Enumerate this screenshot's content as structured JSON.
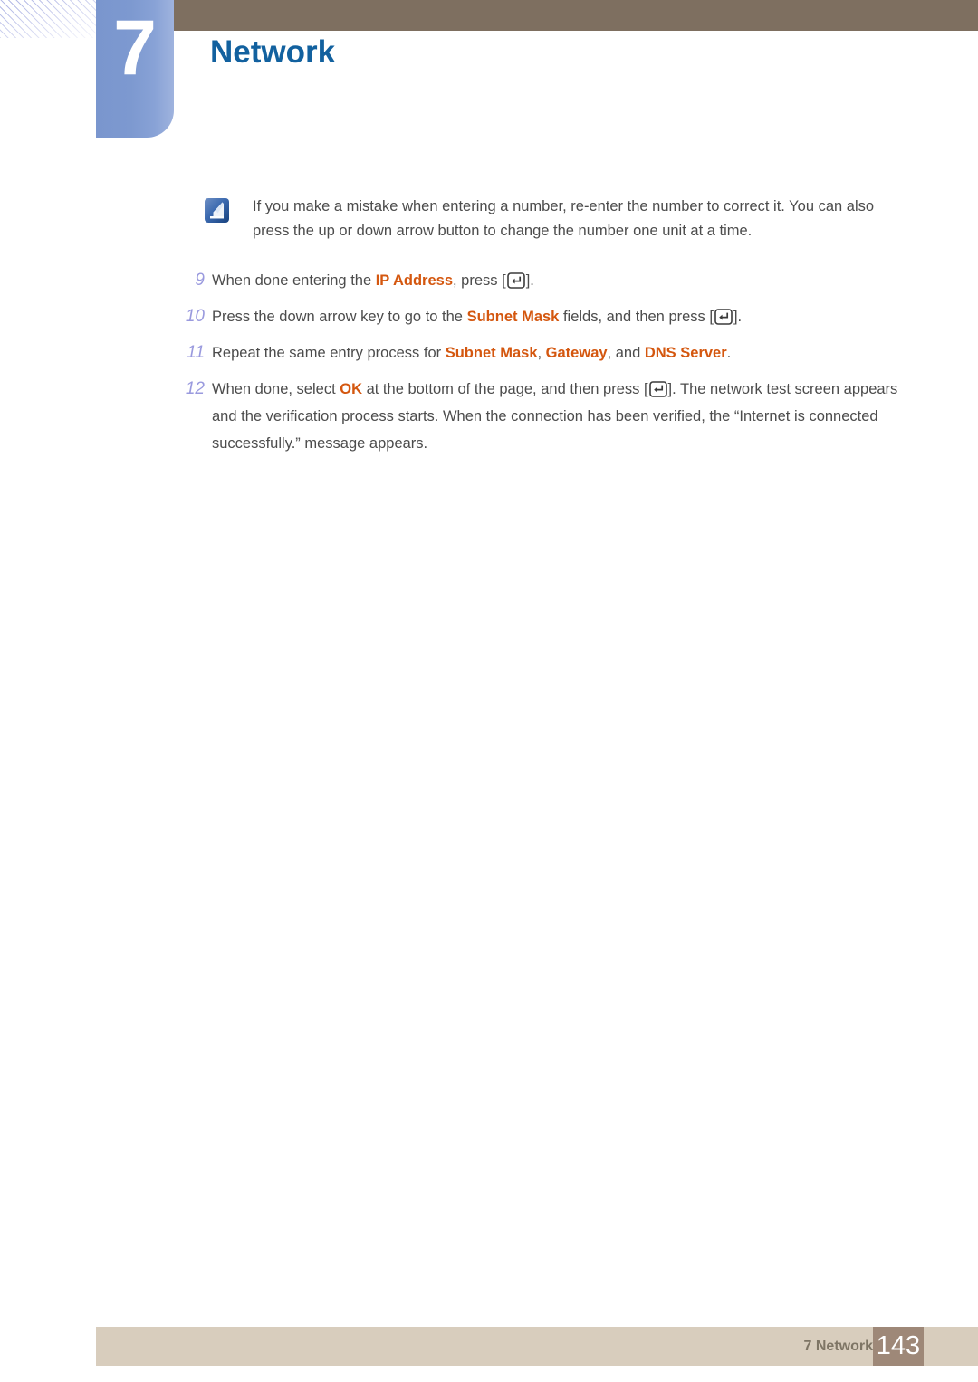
{
  "header": {
    "chapter_number": "7",
    "chapter_title": "Network",
    "accent_blue": "#12619f",
    "badge_blue": "#7d99d0",
    "bar_brown": "#7e6f60"
  },
  "note": {
    "icon": "note-pen-icon",
    "line1": "If you make a mistake when entering a number, re-enter the number to correct it. You can also",
    "line2": "press the up or down arrow button to change the number one unit at a time."
  },
  "steps": [
    {
      "number": "9",
      "parts": [
        {
          "type": "text",
          "value": "When done entering the "
        },
        {
          "type": "highlight",
          "value": "IP Address"
        },
        {
          "type": "text",
          "value": ", press ["
        },
        {
          "type": "icon",
          "value": "enter-key-icon"
        },
        {
          "type": "text",
          "value": "]."
        }
      ]
    },
    {
      "number": "10",
      "parts": [
        {
          "type": "text",
          "value": "Press the down arrow key to go to the "
        },
        {
          "type": "highlight",
          "value": "Subnet Mask"
        },
        {
          "type": "text",
          "value": " fields, and then press ["
        },
        {
          "type": "icon",
          "value": "enter-key-icon"
        },
        {
          "type": "text",
          "value": "]."
        }
      ]
    },
    {
      "number": "11",
      "parts": [
        {
          "type": "text",
          "value": "Repeat the same entry process for "
        },
        {
          "type": "highlight",
          "value": "Subnet Mask"
        },
        {
          "type": "text",
          "value": ", "
        },
        {
          "type": "highlight",
          "value": "Gateway"
        },
        {
          "type": "text",
          "value": ", and "
        },
        {
          "type": "highlight",
          "value": "DNS Server"
        },
        {
          "type": "text",
          "value": "."
        }
      ]
    },
    {
      "number": "12",
      "parts": [
        {
          "type": "text",
          "value": "When done, select "
        },
        {
          "type": "highlight",
          "value": "OK"
        },
        {
          "type": "text",
          "value": " at the bottom of the page, and then press ["
        },
        {
          "type": "icon",
          "value": "enter-key-icon"
        },
        {
          "type": "text",
          "value": "]. The network test screen appears and the verification process starts. When the connection has been verified, the “Internet is connected successfully.” message appears."
        }
      ]
    }
  ],
  "footer": {
    "label": "7 Network",
    "page_number": "143",
    "bar_color": "#d8cdbd",
    "page_box_color": "#9e8878"
  },
  "colors": {
    "highlight_orange": "#d4570f",
    "step_number_periwinkle": "#9a9ade",
    "body_text": "#4c4c4c"
  }
}
